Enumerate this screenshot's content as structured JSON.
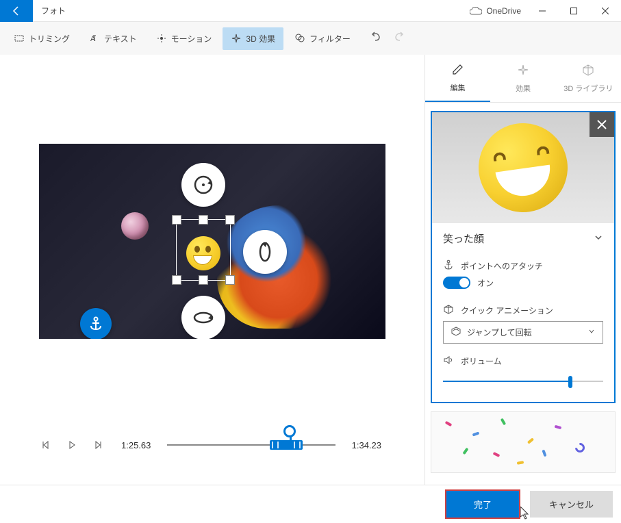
{
  "titlebar": {
    "app_name": "フォト",
    "onedrive_label": "OneDrive"
  },
  "toolbar": {
    "trim": "トリミング",
    "text": "テキスト",
    "motion": "モーション",
    "effects3d": "3D 効果",
    "filter": "フィルター"
  },
  "playback": {
    "current_time": "1:25.63",
    "end_time": "1:34.23"
  },
  "panel_tabs": {
    "edit": "編集",
    "effects": "効果",
    "library3d": "3D ライブラリ"
  },
  "card": {
    "title": "笑った顔",
    "attach_label": "ポイントへのアタッチ",
    "attach_state": "オン",
    "anim_label": "クイック アニメーション",
    "anim_value": "ジャンプして回転",
    "volume_label": "ボリューム"
  },
  "footer": {
    "done": "完了",
    "cancel": "キャンセル"
  }
}
